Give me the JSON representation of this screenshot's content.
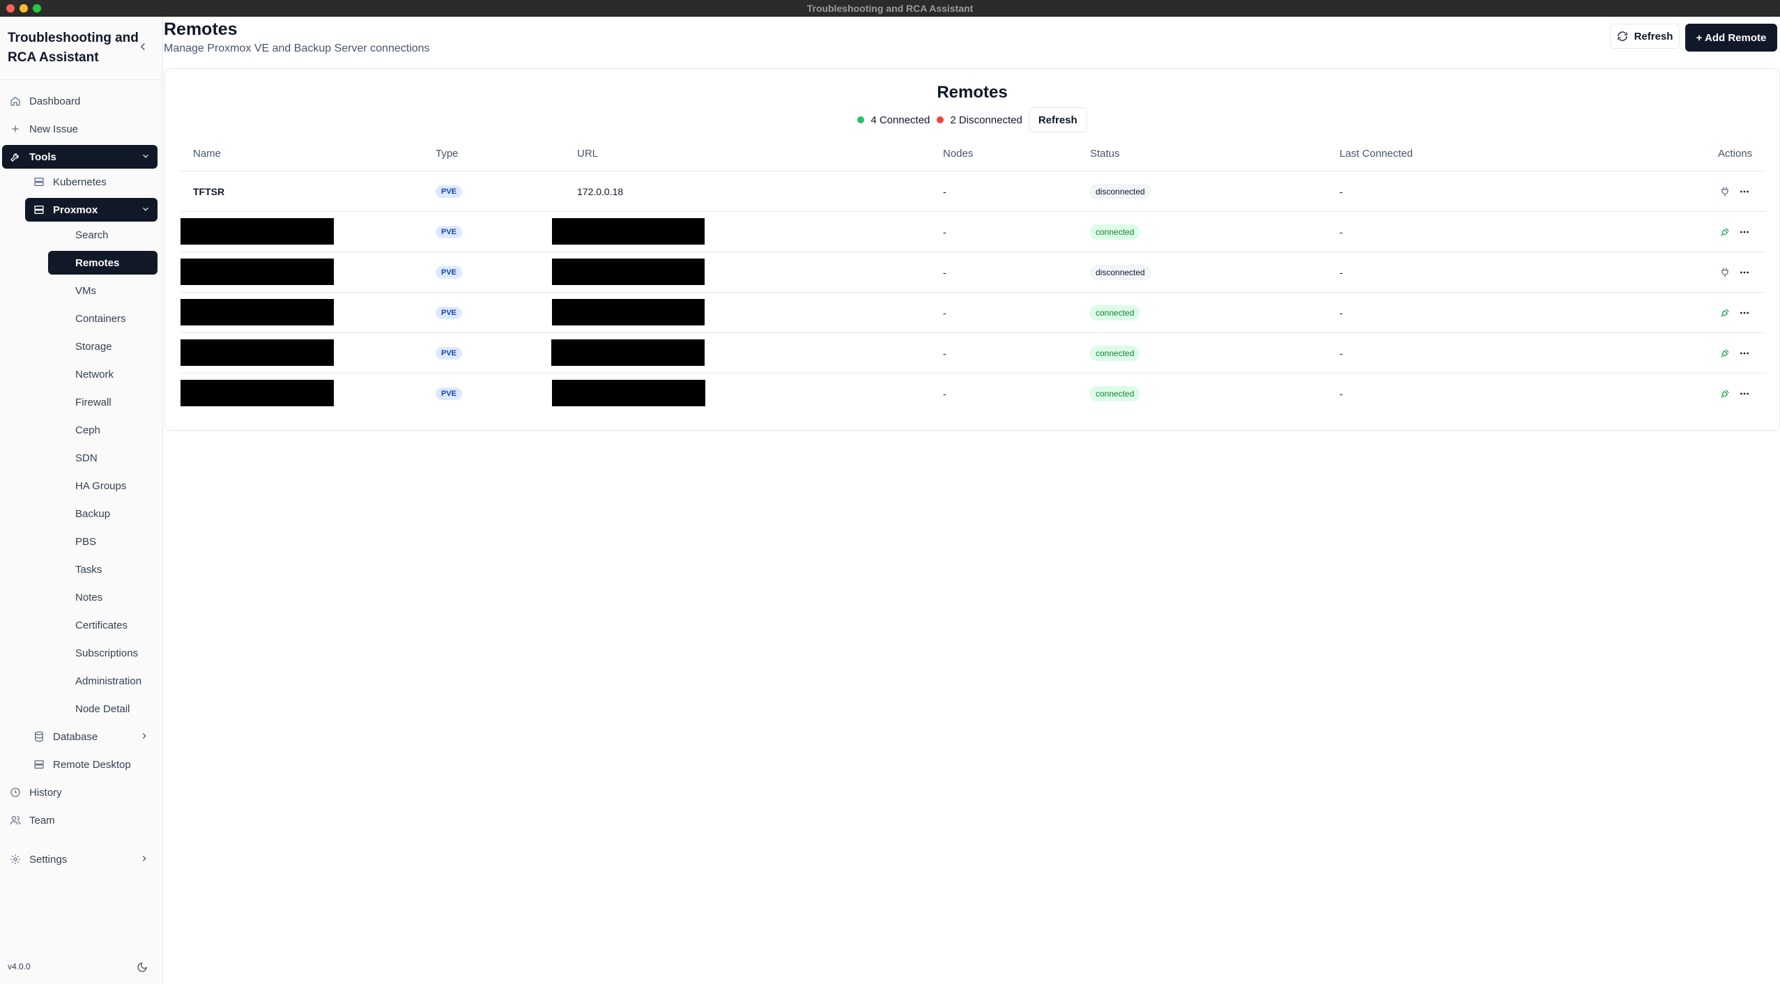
{
  "window": {
    "title": "Troubleshooting and RCA Assistant"
  },
  "sidebar": {
    "brand": "Troubleshooting and RCA Assistant",
    "nav": {
      "dashboard": "Dashboard",
      "new_issue": "New Issue",
      "tools": "Tools",
      "kubernetes": "Kubernetes",
      "proxmox": "Proxmox",
      "database": "Database",
      "remote_desktop": "Remote Desktop",
      "history": "History",
      "team": "Team",
      "settings": "Settings"
    },
    "proxmox_items": [
      "Search",
      "Remotes",
      "VMs",
      "Containers",
      "Storage",
      "Network",
      "Firewall",
      "Ceph",
      "SDN",
      "HA Groups",
      "Backup",
      "PBS",
      "Tasks",
      "Notes",
      "Certificates",
      "Subscriptions",
      "Administration",
      "Node Detail"
    ],
    "active_item": "Remotes",
    "version": "v4.0.0"
  },
  "header": {
    "title": "Remotes",
    "subtitle": "Manage Proxmox VE and Backup Server connections",
    "refresh_label": "Refresh",
    "add_label": "+ Add Remote"
  },
  "card": {
    "title": "Remotes",
    "connected_text": "4 Connected",
    "disconnected_text": "2 Disconnected",
    "refresh_label": "Refresh",
    "columns": {
      "name": "Name",
      "type": "Type",
      "url": "URL",
      "nodes": "Nodes",
      "status": "Status",
      "last": "Last Connected",
      "actions": "Actions"
    },
    "rows": [
      {
        "name": "TFTSR",
        "type": "PVE",
        "url": "172.0.0.18",
        "nodes": "-",
        "status": "disconnected",
        "last": "-"
      },
      {
        "name": "",
        "type": "PVE",
        "url": "",
        "nodes": "-",
        "status": "connected",
        "last": "-"
      },
      {
        "name": "",
        "type": "PVE",
        "url": "",
        "nodes": "-",
        "status": "disconnected",
        "last": "-"
      },
      {
        "name": "",
        "type": "PVE",
        "url": "",
        "nodes": "-",
        "status": "connected",
        "last": "-"
      },
      {
        "name": "",
        "type": "PVE",
        "url": "",
        "nodes": "-",
        "status": "connected",
        "last": "-"
      },
      {
        "name": "",
        "type": "PVE",
        "url": "",
        "nodes": "-",
        "status": "connected",
        "last": "-"
      }
    ]
  },
  "colors": {
    "accent_dark": "#111827",
    "connected": "#22c55e",
    "disconnected": "#ef4444"
  }
}
